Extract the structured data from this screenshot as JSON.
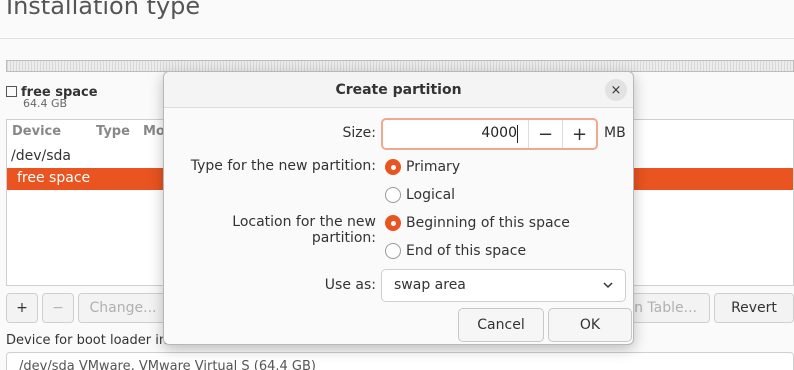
{
  "page": {
    "title": "Installation type",
    "free_space_label": "free space",
    "free_space_size": "64.4 GB",
    "table": {
      "columns": [
        "Device",
        "Type",
        "Mo"
      ],
      "rows": [
        "/dev/sda",
        "free space"
      ]
    },
    "toolbar": {
      "add": "+",
      "remove": "−",
      "change": "Change...",
      "new_table": "n Table...",
      "revert": "Revert"
    },
    "boot_loader_label": "Device for boot loader installation:",
    "boot_loader_value": "/dev/sda VMware, VMware Virtual S (64.4 GB)"
  },
  "dialog": {
    "title": "Create partition",
    "close_icon": "×",
    "size_label": "Size:",
    "size_value": "4000",
    "size_unit": "MB",
    "decrement": "−",
    "increment": "+",
    "type_label": "Type for the new partition:",
    "type_options": [
      "Primary",
      "Logical"
    ],
    "type_selected": "Primary",
    "location_label": "Location for the new partition:",
    "location_options": [
      "Beginning of this space",
      "End of this space"
    ],
    "location_selected": "Beginning of this space",
    "use_as_label": "Use as:",
    "use_as_value": "swap area",
    "cancel": "Cancel",
    "ok": "OK"
  },
  "colors": {
    "accent": "#e95420",
    "focus_border": "#f0a98e"
  }
}
